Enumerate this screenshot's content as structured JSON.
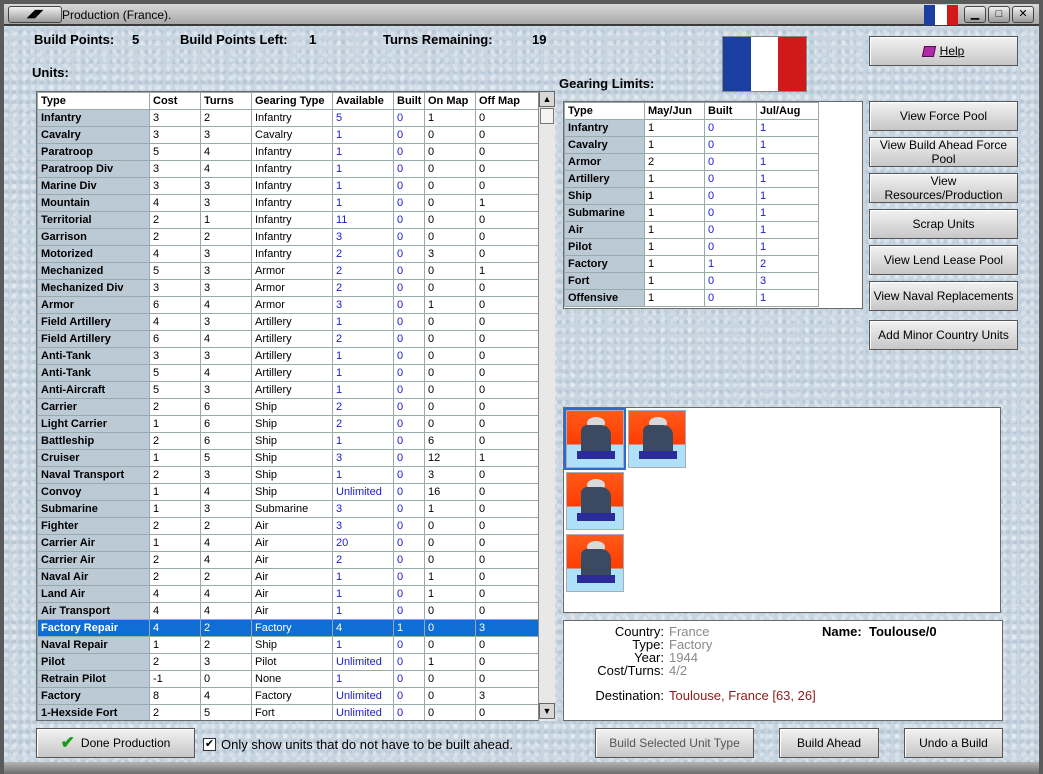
{
  "window": {
    "title": "Production (France).",
    "flag_colors": [
      "#1a3fa0",
      "#ffffff",
      "#d01a1a"
    ]
  },
  "stats": {
    "build_points_label": "Build Points:",
    "build_points": "5",
    "build_points_left_label": "Build Points Left:",
    "build_points_left": "1",
    "turns_remaining_label": "Turns Remaining:",
    "turns_remaining": "19"
  },
  "units": {
    "label": "Units:",
    "headers": [
      "Type",
      "Cost",
      "Turns",
      "Gearing Type",
      "Available",
      "Built",
      "On Map",
      "Off Map"
    ],
    "rows": [
      [
        "Infantry",
        "3",
        "2",
        "Infantry",
        "5",
        "0",
        "1",
        "0"
      ],
      [
        "Cavalry",
        "3",
        "3",
        "Cavalry",
        "1",
        "0",
        "0",
        "0"
      ],
      [
        "Paratroop",
        "5",
        "4",
        "Infantry",
        "1",
        "0",
        "0",
        "0"
      ],
      [
        "Paratroop Div",
        "3",
        "4",
        "Infantry",
        "1",
        "0",
        "0",
        "0"
      ],
      [
        "Marine Div",
        "3",
        "3",
        "Infantry",
        "1",
        "0",
        "0",
        "0"
      ],
      [
        "Mountain",
        "4",
        "3",
        "Infantry",
        "1",
        "0",
        "0",
        "1"
      ],
      [
        "Territorial",
        "2",
        "1",
        "Infantry",
        "11",
        "0",
        "0",
        "0"
      ],
      [
        "Garrison",
        "2",
        "2",
        "Infantry",
        "3",
        "0",
        "0",
        "0"
      ],
      [
        "Motorized",
        "4",
        "3",
        "Infantry",
        "2",
        "0",
        "3",
        "0"
      ],
      [
        "Mechanized",
        "5",
        "3",
        "Armor",
        "2",
        "0",
        "0",
        "1"
      ],
      [
        "Mechanized Div",
        "3",
        "3",
        "Armor",
        "2",
        "0",
        "0",
        "0"
      ],
      [
        "Armor",
        "6",
        "4",
        "Armor",
        "3",
        "0",
        "1",
        "0"
      ],
      [
        "Field Artillery",
        "4",
        "3",
        "Artillery",
        "1",
        "0",
        "0",
        "0"
      ],
      [
        "Field Artillery",
        "6",
        "4",
        "Artillery",
        "2",
        "0",
        "0",
        "0"
      ],
      [
        "Anti-Tank",
        "3",
        "3",
        "Artillery",
        "1",
        "0",
        "0",
        "0"
      ],
      [
        "Anti-Tank",
        "5",
        "4",
        "Artillery",
        "1",
        "0",
        "0",
        "0"
      ],
      [
        "Anti-Aircraft",
        "5",
        "3",
        "Artillery",
        "1",
        "0",
        "0",
        "0"
      ],
      [
        "Carrier",
        "2",
        "6",
        "Ship",
        "2",
        "0",
        "0",
        "0"
      ],
      [
        "Light Carrier",
        "1",
        "6",
        "Ship",
        "2",
        "0",
        "0",
        "0"
      ],
      [
        "Battleship",
        "2",
        "6",
        "Ship",
        "1",
        "0",
        "6",
        "0"
      ],
      [
        "Cruiser",
        "1",
        "5",
        "Ship",
        "3",
        "0",
        "12",
        "1"
      ],
      [
        "Naval Transport",
        "2",
        "3",
        "Ship",
        "1",
        "0",
        "3",
        "0"
      ],
      [
        "Convoy",
        "1",
        "4",
        "Ship",
        "Unlimited",
        "0",
        "16",
        "0"
      ],
      [
        "Submarine",
        "1",
        "3",
        "Submarine",
        "3",
        "0",
        "1",
        "0"
      ],
      [
        "Fighter",
        "2",
        "2",
        "Air",
        "3",
        "0",
        "0",
        "0"
      ],
      [
        "Carrier Air",
        "1",
        "4",
        "Air",
        "20",
        "0",
        "0",
        "0"
      ],
      [
        "Carrier Air",
        "2",
        "4",
        "Air",
        "2",
        "0",
        "0",
        "0"
      ],
      [
        "Naval Air",
        "2",
        "2",
        "Air",
        "1",
        "0",
        "1",
        "0"
      ],
      [
        "Land Air",
        "4",
        "4",
        "Air",
        "1",
        "0",
        "1",
        "0"
      ],
      [
        "Air Transport",
        "4",
        "4",
        "Air",
        "1",
        "0",
        "0",
        "0"
      ],
      [
        "Factory Repair",
        "4",
        "2",
        "Factory",
        "4",
        "1",
        "0",
        "3"
      ],
      [
        "Naval Repair",
        "1",
        "2",
        "Ship",
        "1",
        "0",
        "0",
        "0"
      ],
      [
        "Pilot",
        "2",
        "3",
        "Pilot",
        "Unlimited",
        "0",
        "1",
        "0"
      ],
      [
        "Retrain Pilot",
        "-1",
        "0",
        "None",
        "1",
        "0",
        "0",
        "0"
      ],
      [
        "Factory",
        "8",
        "4",
        "Factory",
        "Unlimited",
        "0",
        "0",
        "3"
      ],
      [
        "1-Hexside Fort",
        "2",
        "5",
        "Fort",
        "Unlimited",
        "0",
        "0",
        "0"
      ]
    ],
    "selected_row": 30
  },
  "gearing": {
    "label": "Gearing Limits:",
    "headers": [
      "Type",
      "May/Jun",
      "Built",
      "Jul/Aug"
    ],
    "rows": [
      [
        "Infantry",
        "1",
        "0",
        "1"
      ],
      [
        "Cavalry",
        "1",
        "0",
        "1"
      ],
      [
        "Armor",
        "2",
        "0",
        "1"
      ],
      [
        "Artillery",
        "1",
        "0",
        "1"
      ],
      [
        "Ship",
        "1",
        "0",
        "1"
      ],
      [
        "Submarine",
        "1",
        "0",
        "1"
      ],
      [
        "Air",
        "1",
        "0",
        "1"
      ],
      [
        "Pilot",
        "1",
        "0",
        "1"
      ],
      [
        "Factory",
        "1",
        "1",
        "2"
      ],
      [
        "Fort",
        "1",
        "0",
        "3"
      ],
      [
        "Offensive",
        "1",
        "0",
        "1"
      ]
    ]
  },
  "buttons": {
    "help": "Help",
    "view_force_pool": "View Force Pool",
    "view_build_ahead": "View Build Ahead Force Pool",
    "view_resources": "View Resources/Production",
    "scrap_units": "Scrap Units",
    "view_lend_lease": "View Lend Lease Pool",
    "view_naval": "View Naval Replacements",
    "add_minor": "Add Minor Country Units",
    "done_production": "Done Production",
    "build_selected": "Build Selected Unit Type",
    "build_ahead": "Build Ahead",
    "undo_build": "Undo a Build"
  },
  "checkbox": {
    "label": "Only show units that do not have to be built ahead.",
    "checked": true
  },
  "detail": {
    "country_label": "Country:",
    "country": "France",
    "type_label": "Type:",
    "type": "Factory",
    "year_label": "Year:",
    "year": "1944",
    "cost_turns_label": "Cost/Turns:",
    "cost_turns": "4/2",
    "name_label": "Name:",
    "name": "Toulouse/0",
    "destination_label": "Destination:",
    "destination": "Toulouse, France [63, 26]"
  },
  "icons": [
    "factory-unit-icon",
    "factory-unit-icon",
    "factory-unit-icon",
    "factory-unit-icon"
  ]
}
